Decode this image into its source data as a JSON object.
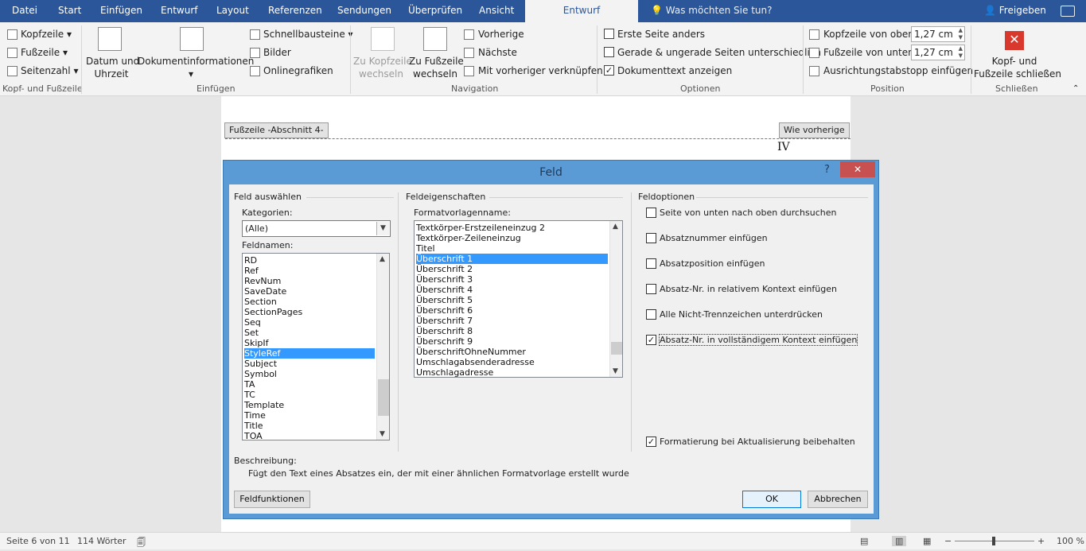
{
  "tabs": {
    "datei": "Datei",
    "start": "Start",
    "einfuegen": "Einfügen",
    "entwurf": "Entwurf",
    "layout": "Layout",
    "referenzen": "Referenzen",
    "sendungen": "Sendungen",
    "ueberpruefen": "Überprüfen",
    "ansicht": "Ansicht",
    "entwurf_active": "Entwurf",
    "help": "Was möchten Sie tun?",
    "share": "Freigeben"
  },
  "ribbon": {
    "kopfzeile": "Kopfzeile",
    "fusszeile": "Fußzeile",
    "seitenzahl": "Seitenzahl",
    "grp_kopf": "Kopf- und Fußzeile",
    "datum_l1": "Datum und",
    "datum_l2": "Uhrzeit",
    "dokinfo": "Dokumentinformationen",
    "schnell": "Schnellbausteine",
    "bilder": "Bilder",
    "online": "Onlinegrafiken",
    "grp_einfuegen": "Einfügen",
    "zukopf_l1": "Zu Kopfzeile",
    "zukopf_l2": "wechseln",
    "zufuss_l1": "Zu Fußzeile",
    "zufuss_l2": "wechseln",
    "vorherige": "Vorherige",
    "naechste": "Nächste",
    "verknuepfen": "Mit vorheriger verknüpfen",
    "grp_navigation": "Navigation",
    "erste": "Erste Seite anders",
    "gerade": "Gerade & ungerade Seiten unterschiedlich",
    "doktext": "Dokumenttext anzeigen",
    "grp_optionen": "Optionen",
    "kopf_oben": "Kopfzeile von oben:",
    "kopf_oben_val": "1,27 cm",
    "fuss_unten": "Fußzeile von unten:",
    "fuss_unten_val": "1,27 cm",
    "ausricht": "Ausrichtungstabstopp einfügen",
    "grp_position": "Position",
    "schliessen_l1": "Kopf- und",
    "schliessen_l2": "Fußzeile schließen",
    "grp_schliessen": "Schließen"
  },
  "document": {
    "footer_tag": "Fußzeile -Abschnitt 4-",
    "same_as_prev": "Wie vorherige",
    "page_number": "IV"
  },
  "dialog": {
    "title": "Feld",
    "help": "?",
    "close": "✕",
    "sec_feld": "Feld auswählen",
    "kategorien_label": "Kategorien:",
    "kategorie_value": "(Alle)",
    "feldnamen_label": "Feldnamen:",
    "feldnamen": [
      "RD",
      "Ref",
      "RevNum",
      "SaveDate",
      "Section",
      "SectionPages",
      "Seq",
      "Set",
      "SkipIf",
      "StyleRef",
      "Subject",
      "Symbol",
      "TA",
      "TC",
      "Template",
      "Time",
      "Title",
      "TOA"
    ],
    "feldnamen_selected": 9,
    "sec_eigen": "Feldeigenschaften",
    "format_label": "Formatvorlagenname:",
    "formate": [
      "Textkörper-Erstzeileneinzug 2",
      "Textkörper-Zeileneinzug",
      "Titel",
      "Überschrift 1",
      "Überschrift 2",
      "Überschrift 3",
      "Überschrift 4",
      "Überschrift 5",
      "Überschrift 6",
      "Überschrift 7",
      "Überschrift 8",
      "Überschrift 9",
      "ÜberschriftOhneNummer",
      "Umschlagabsenderadresse",
      "Umschlagadresse"
    ],
    "formate_selected": 3,
    "sec_optionen": "Feldoptionen",
    "options": [
      {
        "label": "Seite von unten nach oben durchsuchen",
        "checked": false
      },
      {
        "label": "Absatznummer einfügen",
        "checked": false
      },
      {
        "label": "Absatzposition einfügen",
        "checked": false
      },
      {
        "label": "Absatz-Nr. in relativem Kontext einfügen",
        "checked": false
      },
      {
        "label": "Alle Nicht-Trennzeichen unterdrücken",
        "checked": false
      },
      {
        "label": "Absatz-Nr. in vollständigem Kontext einfügen",
        "checked": true
      }
    ],
    "format_keep": "Formatierung bei Aktualisierung beibehalten",
    "beschreibung_label": "Beschreibung:",
    "beschreibung": "Fügt den Text eines Absatzes ein, der mit einer ähnlichen Formatvorlage erstellt wurde",
    "feldfunktionen": "Feldfunktionen",
    "ok": "OK",
    "abbrechen": "Abbrechen"
  },
  "status": {
    "seite": "Seite 6 von 11",
    "woerter": "114 Wörter",
    "zoom": "100 %"
  },
  "colors": {
    "accent": "#2b579a",
    "selection": "#3399ff",
    "dialog_frame": "#5b9bd5"
  }
}
